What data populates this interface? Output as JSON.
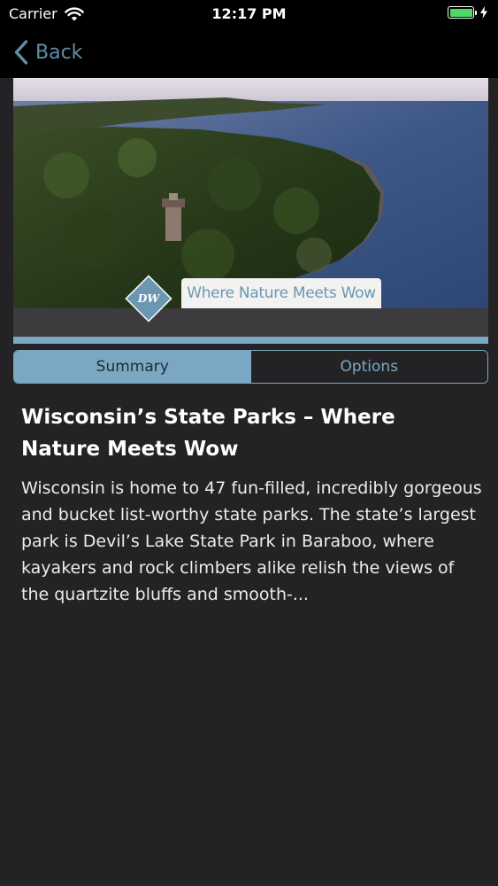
{
  "status_bar": {
    "carrier": "Carrier",
    "time": "12:17 PM",
    "battery_color": "#4cd964"
  },
  "nav": {
    "back_label": "Back",
    "accent_color": "#5f8fa8"
  },
  "video": {
    "caption": "Where Nature Meets Wow",
    "logo_text": "DW",
    "progress": 1.0
  },
  "tabs": [
    {
      "label": "Summary",
      "active": true
    },
    {
      "label": "Options",
      "active": false
    }
  ],
  "article": {
    "title": "Wisconsin’s State Parks – Where Nature Meets Wow",
    "body": "Wisconsin is home to 47 fun-filled, incredibly gorgeous and bucket list-worthy state parks. The state’s largest park is Devil’s Lake State Park in Baraboo, where kayakers and rock climbers alike relish the views of the quartzite bluffs and smooth-..."
  }
}
